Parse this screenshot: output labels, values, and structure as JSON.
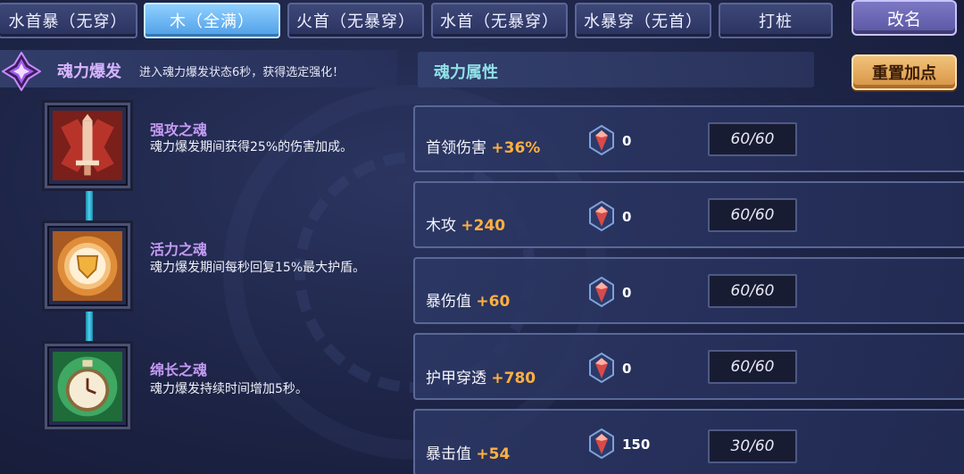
{
  "tabs": [
    {
      "label": "水首暴（无穿）",
      "active": false
    },
    {
      "label": "木（全满）",
      "active": true
    },
    {
      "label": "火首（无暴穿）",
      "active": false
    },
    {
      "label": "水首（无暴穿）",
      "active": false
    },
    {
      "label": "水暴穿（无首）",
      "active": false
    },
    {
      "label": "打桩",
      "active": false
    }
  ],
  "rename_label": "改名",
  "burst": {
    "title": "魂力爆发",
    "description": "进入魂力爆发状态6秒，获得选定强化！",
    "icon": "purple-crystal-icon"
  },
  "souls": [
    {
      "name": "强攻之魂",
      "description": "魂力爆发期间获得25%的伤害加成。",
      "icon": "red-sword-icon"
    },
    {
      "name": "活力之魂",
      "description": "魂力爆发期间每秒回复15%最大护盾。",
      "icon": "orange-shield-icon"
    },
    {
      "name": "绵长之魂",
      "description": "魂力爆发持续时间增加5秒。",
      "icon": "green-stopwatch-icon"
    }
  ],
  "attributes": {
    "title": "魂力属性",
    "reset_label": "重置加点",
    "gem_icon": "soul-gem-icon",
    "rows": [
      {
        "label": "首领伤害",
        "bonus": "+36%",
        "count": "0",
        "cap": "60/60"
      },
      {
        "label": "木攻",
        "bonus": "+240",
        "count": "0",
        "cap": "60/60"
      },
      {
        "label": "暴伤值",
        "bonus": "+60",
        "count": "0",
        "cap": "60/60"
      },
      {
        "label": "护甲穿透",
        "bonus": "+780",
        "count": "0",
        "cap": "60/60"
      },
      {
        "label": "暴击值",
        "bonus": "+54",
        "count": "150",
        "cap": "30/60"
      }
    ]
  },
  "colors": {
    "active_tab": "#6cb6f2",
    "bonus": "#ffb040",
    "soul_name": "#c59bf4",
    "connector": "#4fd1f0"
  }
}
